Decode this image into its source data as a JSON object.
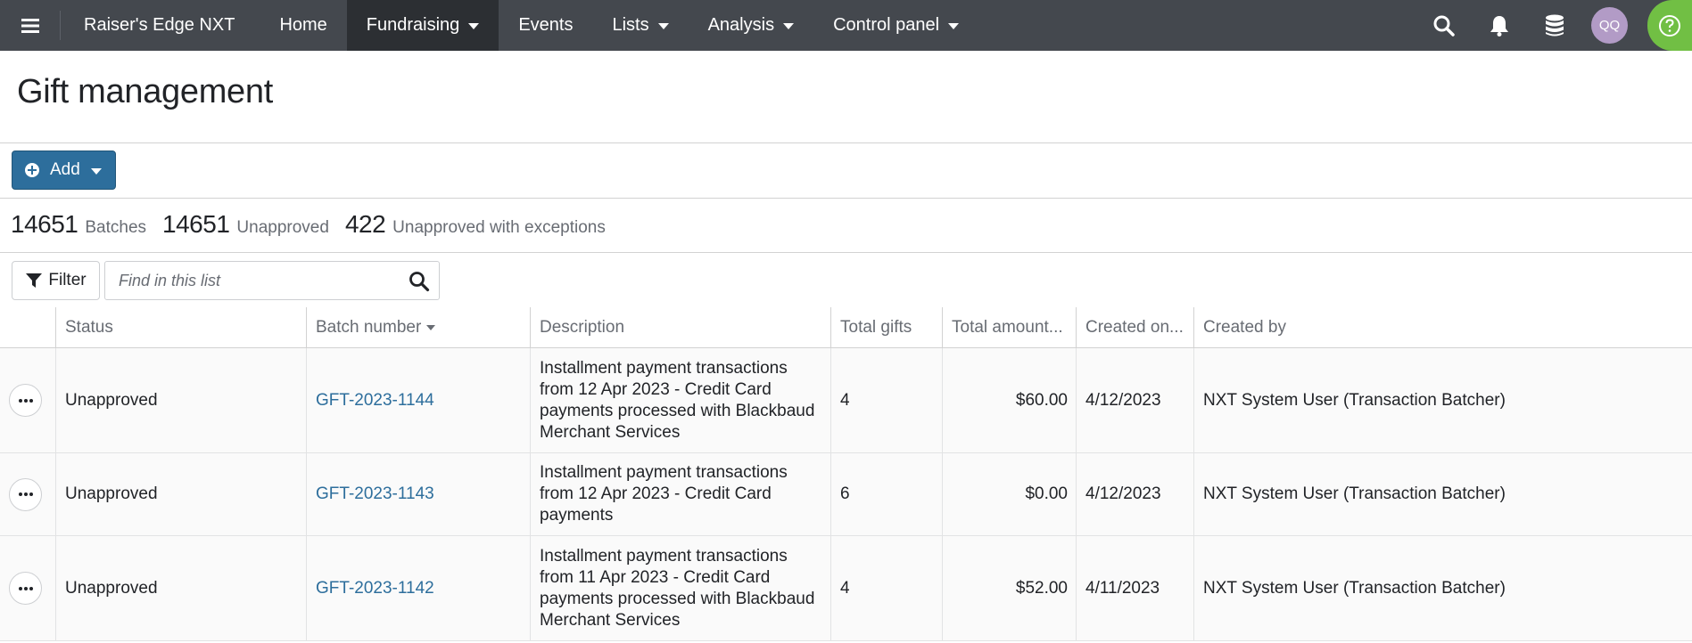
{
  "nav": {
    "brand": "Raiser's Edge NXT",
    "items": [
      {
        "label": "Home",
        "active": false,
        "dropdown": false
      },
      {
        "label": "Fundraising",
        "active": true,
        "dropdown": true
      },
      {
        "label": "Events",
        "active": false,
        "dropdown": false
      },
      {
        "label": "Lists",
        "active": false,
        "dropdown": true
      },
      {
        "label": "Analysis",
        "active": false,
        "dropdown": true
      },
      {
        "label": "Control panel",
        "active": false,
        "dropdown": true
      }
    ],
    "icons": [
      "search-icon",
      "bell-icon",
      "database-icon"
    ],
    "avatar": "QQ",
    "help_icon": "question-icon"
  },
  "page": {
    "title": "Gift management"
  },
  "toolbar": {
    "add_label": "Add"
  },
  "summary": [
    {
      "count": "14651",
      "label": "Batches"
    },
    {
      "count": "14651",
      "label": "Unapproved"
    },
    {
      "count": "422",
      "label": "Unapproved with exceptions"
    }
  ],
  "filter": {
    "label": "Filter",
    "search_placeholder": "Find in this list"
  },
  "grid": {
    "columns": [
      "Status",
      "Batch number",
      "Description",
      "Total gifts",
      "Total amount...",
      "Created on...",
      "Created by"
    ],
    "rows": [
      {
        "status": "Unapproved",
        "batch_number": "GFT-2023-1144",
        "description": "Installment payment transactions from 12 Apr 2023 - Credit Card payments processed with Blackbaud Merchant Services",
        "total_gifts": "4",
        "total_amount": "$60.00",
        "created_on": "4/12/2023",
        "created_by": "NXT System User (Transaction Batcher)"
      },
      {
        "status": "Unapproved",
        "batch_number": "GFT-2023-1143",
        "description": "Installment payment transactions from 12 Apr 2023 - Credit Card payments",
        "total_gifts": "6",
        "total_amount": "$0.00",
        "created_on": "4/12/2023",
        "created_by": "NXT System User (Transaction Batcher)"
      },
      {
        "status": "Unapproved",
        "batch_number": "GFT-2023-1142",
        "description": "Installment payment transactions from 11 Apr 2023 - Credit Card payments processed with Blackbaud Merchant Services",
        "total_gifts": "4",
        "total_amount": "$52.00",
        "created_on": "4/11/2023",
        "created_by": "NXT System User (Transaction Batcher)"
      }
    ]
  }
}
